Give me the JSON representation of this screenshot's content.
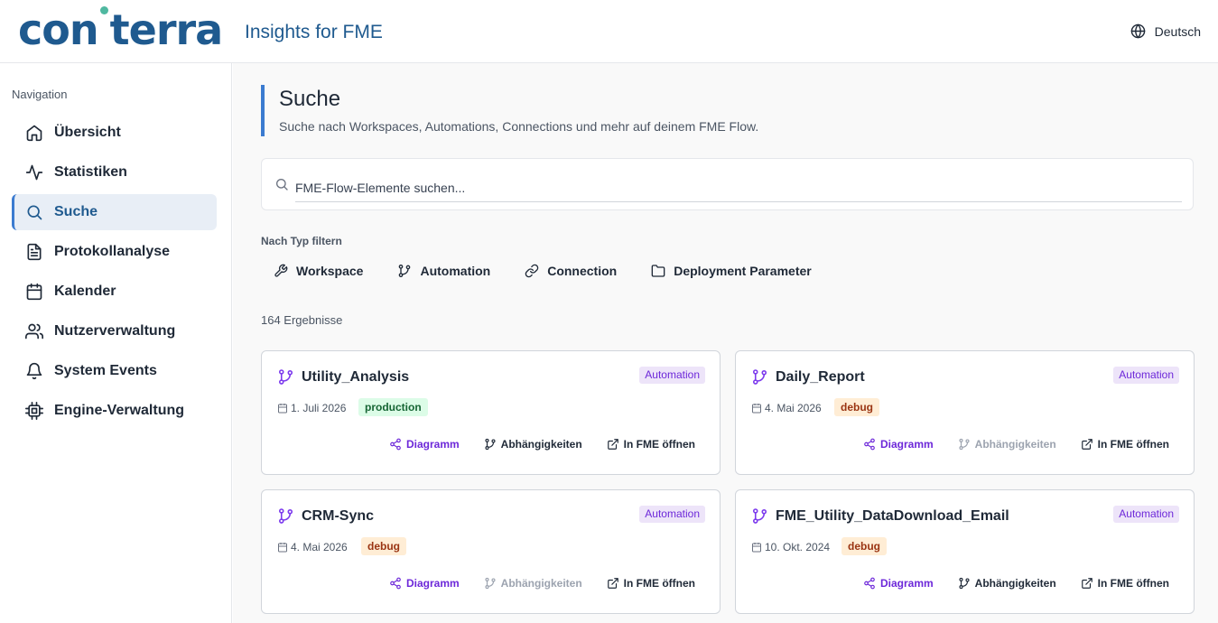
{
  "header": {
    "logo_left": "con",
    "logo_right": "terra",
    "app_title": "Insights for FME",
    "language": "Deutsch"
  },
  "sidebar": {
    "heading": "Navigation",
    "items": [
      {
        "label": "Übersicht",
        "icon": "home-icon"
      },
      {
        "label": "Statistiken",
        "icon": "activity-icon"
      },
      {
        "label": "Suche",
        "icon": "search-icon",
        "active": true
      },
      {
        "label": "Protokollanalyse",
        "icon": "file-text-icon"
      },
      {
        "label": "Kalender",
        "icon": "calendar-icon"
      },
      {
        "label": "Nutzerverwaltung",
        "icon": "users-icon"
      },
      {
        "label": "System Events",
        "icon": "bell-icon"
      },
      {
        "label": "Engine-Verwaltung",
        "icon": "cpu-icon"
      }
    ]
  },
  "main": {
    "title": "Suche",
    "subtitle": "Suche nach Workspaces, Automations, Connections und mehr auf deinem FME Flow.",
    "search": {
      "placeholder": "FME-Flow-Elemente suchen...",
      "value": ""
    },
    "filter_label": "Nach Typ filtern",
    "filters": [
      {
        "label": "Workspace",
        "icon": "wrench-icon"
      },
      {
        "label": "Automation",
        "icon": "git-branch-icon"
      },
      {
        "label": "Connection",
        "icon": "link-icon"
      },
      {
        "label": "Deployment Parameter",
        "icon": "folder-icon"
      }
    ],
    "results_count": "164 Ergebnisse",
    "actions": {
      "diagram": "Diagramm",
      "dependencies": "Abhängigkeiten",
      "open": "In FME öffnen"
    },
    "results": [
      {
        "title": "Utility_Analysis",
        "type": "Automation",
        "date": "1. Juli 2026",
        "env": "production",
        "dependencies_enabled": true
      },
      {
        "title": "Daily_Report",
        "type": "Automation",
        "date": "4. Mai 2026",
        "env": "debug",
        "dependencies_enabled": false
      },
      {
        "title": "CRM-Sync",
        "type": "Automation",
        "date": "4. Mai 2026",
        "env": "debug",
        "dependencies_enabled": false
      },
      {
        "title": "FME_Utility_DataDownload_Email",
        "type": "Automation",
        "date": "10. Okt. 2024",
        "env": "debug",
        "dependencies_enabled": true
      }
    ]
  },
  "colors": {
    "brand": "#1f5a8f",
    "accent": "#3b7bd0",
    "automation_purple": "#6d28d9",
    "production_bg": "#dcfce7",
    "debug_bg": "#ffedd5"
  }
}
